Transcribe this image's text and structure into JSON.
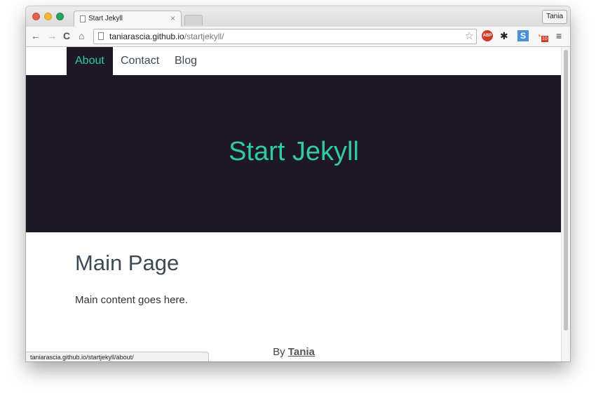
{
  "browser": {
    "tab_title": "Start Jekyll",
    "tab_close": "×",
    "profile_name": "Tania",
    "url_host": "taniarascia.github.io",
    "url_path": "/startjekyll/",
    "status_url": "taniarascia.github.io/startjekyll/about/",
    "extensions": {
      "abp_label": "ABP",
      "s_label": "S",
      "rss_badge": "10"
    },
    "icons": {
      "back": "←",
      "forward": "→",
      "reload": "C",
      "home": "⌂",
      "star": "☆",
      "gear": "✱",
      "rss": "◔",
      "menu": "≡"
    }
  },
  "page": {
    "nav": [
      {
        "label": "About",
        "active": true
      },
      {
        "label": "Contact",
        "active": false
      },
      {
        "label": "Blog",
        "active": false
      }
    ],
    "hero_title": "Start Jekyll",
    "main_title": "Main Page",
    "main_content": "Main content goes here.",
    "footer_prefix": "By ",
    "footer_author": "Tania"
  },
  "colors": {
    "accent": "#2ecc9f",
    "hero_bg": "#1e1726",
    "heading": "#3c4a55"
  }
}
